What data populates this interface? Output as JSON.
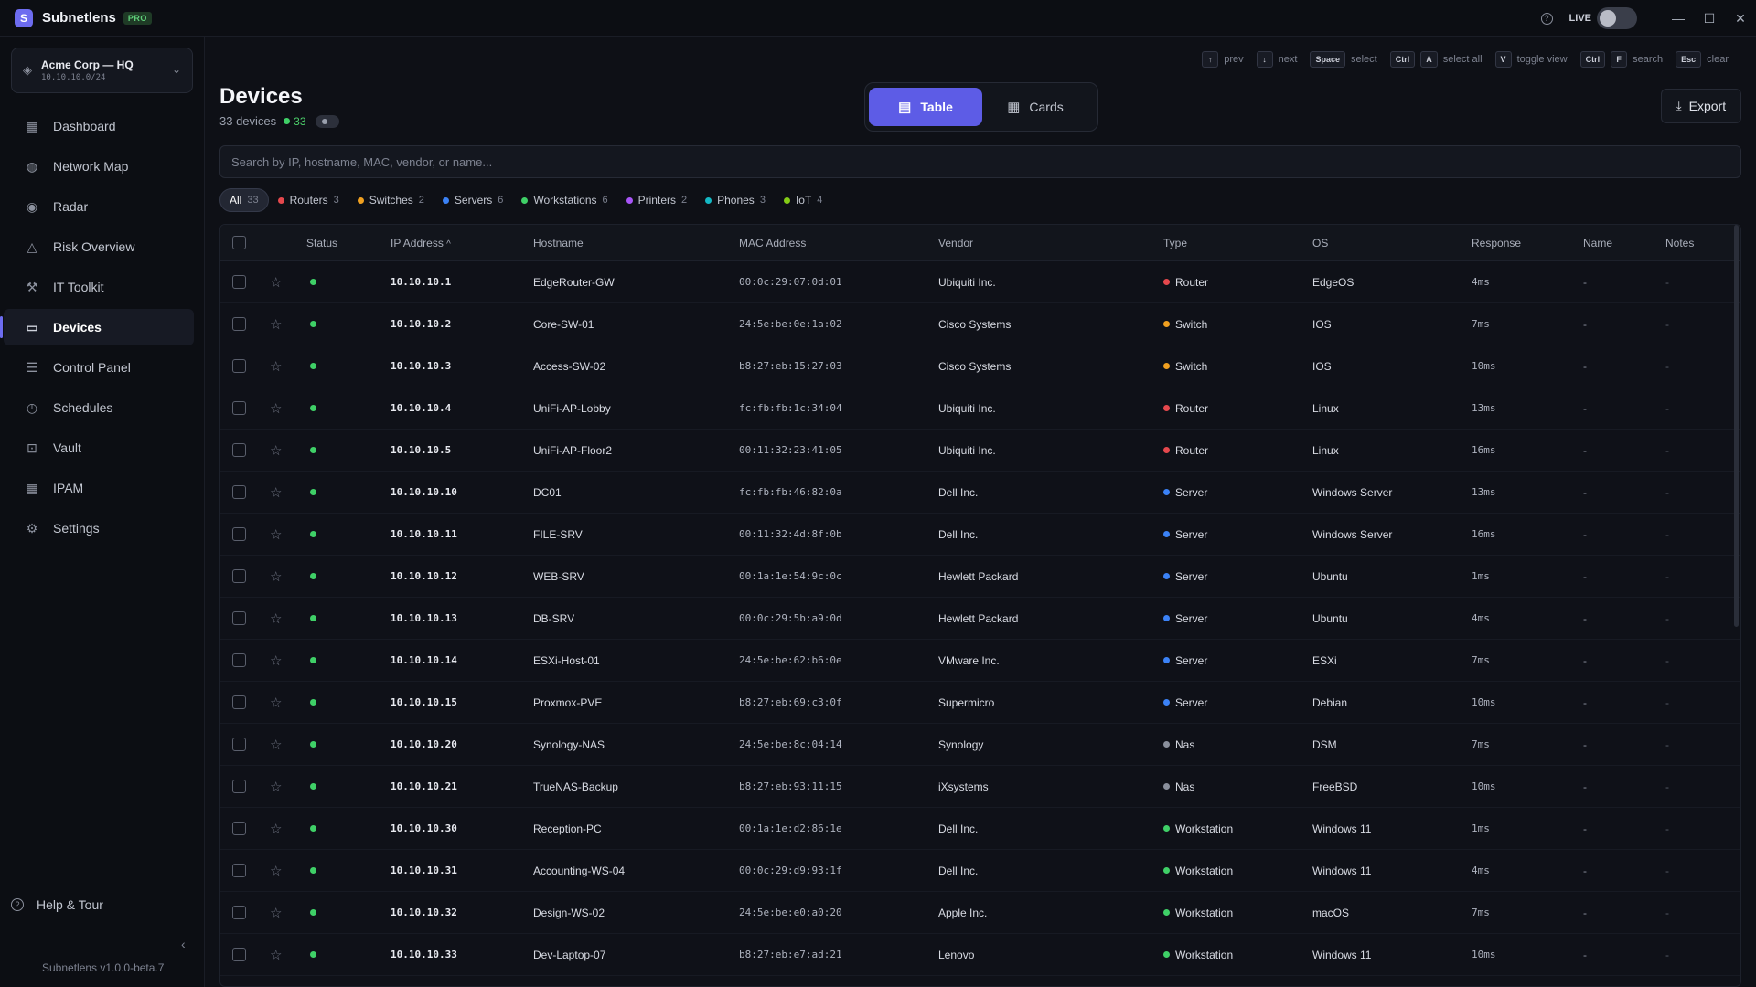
{
  "app": {
    "name": "Subnetlens",
    "badge": "PRO",
    "live_label": "LIVE",
    "version": "Subnetlens v1.0.0-beta.7"
  },
  "workspace": {
    "name": "Acme Corp — HQ",
    "subnet": "10.10.10.0/24"
  },
  "nav": [
    {
      "label": "Dashboard",
      "icon": "dashboard-icon",
      "glyph": "▦"
    },
    {
      "label": "Network Map",
      "icon": "globe-icon",
      "glyph": "◍"
    },
    {
      "label": "Radar",
      "icon": "radar-icon",
      "glyph": "◉"
    },
    {
      "label": "Risk Overview",
      "icon": "warning-icon",
      "glyph": "△"
    },
    {
      "label": "IT Toolkit",
      "icon": "toolkit-icon",
      "glyph": "⚒"
    },
    {
      "label": "Devices",
      "icon": "monitor-icon",
      "glyph": "▭"
    },
    {
      "label": "Control Panel",
      "icon": "sliders-icon",
      "glyph": "☰"
    },
    {
      "label": "Schedules",
      "icon": "clock-icon",
      "glyph": "◷"
    },
    {
      "label": "Vault",
      "icon": "lock-icon",
      "glyph": "⊡"
    },
    {
      "label": "IPAM",
      "icon": "grid-icon",
      "glyph": "▦"
    },
    {
      "label": "Settings",
      "icon": "gear-icon",
      "glyph": "⚙"
    }
  ],
  "active_nav": "Devices",
  "help": {
    "label": "Help & Tour"
  },
  "shortcuts": [
    {
      "keys": [
        "↑"
      ],
      "label": "prev"
    },
    {
      "keys": [
        "↓"
      ],
      "label": "next"
    },
    {
      "keys": [
        "Space"
      ],
      "label": "select"
    },
    {
      "keys": [
        "Ctrl",
        "A"
      ],
      "label": "select all"
    },
    {
      "keys": [
        "V"
      ],
      "label": "toggle view"
    },
    {
      "keys": [
        "Ctrl",
        "F"
      ],
      "label": "search"
    },
    {
      "keys": [
        "Esc"
      ],
      "label": "clear"
    }
  ],
  "page": {
    "title": "Devices",
    "device_count": "33 devices",
    "online_count": "33"
  },
  "view_switch": {
    "table_label": "Table",
    "cards_label": "Cards",
    "active": "Table"
  },
  "export_label": "Export",
  "search": {
    "placeholder": "Search by IP, hostname, MAC, vendor, or name...",
    "value": ""
  },
  "filters": [
    {
      "label": "All",
      "count": "33",
      "color": "",
      "active": true
    },
    {
      "label": "Routers",
      "count": "3",
      "color": "#e5484d"
    },
    {
      "label": "Switches",
      "count": "2",
      "color": "#f0a020"
    },
    {
      "label": "Servers",
      "count": "6",
      "color": "#3b82f6"
    },
    {
      "label": "Workstations",
      "count": "6",
      "color": "#3fd067"
    },
    {
      "label": "Printers",
      "count": "2",
      "color": "#a855f7"
    },
    {
      "label": "Phones",
      "count": "3",
      "color": "#14b8c4"
    },
    {
      "label": "IoT",
      "count": "4",
      "color": "#84cc16"
    }
  ],
  "table": {
    "columns": [
      "Status",
      "IP Address",
      "Hostname",
      "MAC Address",
      "Vendor",
      "Type",
      "OS",
      "Response",
      "Name",
      "Notes"
    ],
    "sort_indicator": "^",
    "type_colors": {
      "Router": "#e5484d",
      "Switch": "#f0a020",
      "Server": "#3b82f6",
      "Nas": "#8a8f9c",
      "Workstation": "#3fd067"
    },
    "rows": [
      {
        "ip": "10.10.10.1",
        "host": "EdgeRouter-GW",
        "mac": "00:0c:29:07:0d:01",
        "vendor": "Ubiquiti Inc.",
        "type": "Router",
        "os": "EdgeOS",
        "resp": "4ms",
        "name": "-",
        "notes": "-"
      },
      {
        "ip": "10.10.10.2",
        "host": "Core-SW-01",
        "mac": "24:5e:be:0e:1a:02",
        "vendor": "Cisco Systems",
        "type": "Switch",
        "os": "IOS",
        "resp": "7ms",
        "name": "-",
        "notes": "-"
      },
      {
        "ip": "10.10.10.3",
        "host": "Access-SW-02",
        "mac": "b8:27:eb:15:27:03",
        "vendor": "Cisco Systems",
        "type": "Switch",
        "os": "IOS",
        "resp": "10ms",
        "name": "-",
        "notes": "-"
      },
      {
        "ip": "10.10.10.4",
        "host": "UniFi-AP-Lobby",
        "mac": "fc:fb:fb:1c:34:04",
        "vendor": "Ubiquiti Inc.",
        "type": "Router",
        "os": "Linux",
        "resp": "13ms",
        "name": "-",
        "notes": "-"
      },
      {
        "ip": "10.10.10.5",
        "host": "UniFi-AP-Floor2",
        "mac": "00:11:32:23:41:05",
        "vendor": "Ubiquiti Inc.",
        "type": "Router",
        "os": "Linux",
        "resp": "16ms",
        "name": "-",
        "notes": "-"
      },
      {
        "ip": "10.10.10.10",
        "host": "DC01",
        "mac": "fc:fb:fb:46:82:0a",
        "vendor": "Dell Inc.",
        "type": "Server",
        "os": "Windows Server",
        "resp": "13ms",
        "name": "-",
        "notes": "-"
      },
      {
        "ip": "10.10.10.11",
        "host": "FILE-SRV",
        "mac": "00:11:32:4d:8f:0b",
        "vendor": "Dell Inc.",
        "type": "Server",
        "os": "Windows Server",
        "resp": "16ms",
        "name": "-",
        "notes": "-"
      },
      {
        "ip": "10.10.10.12",
        "host": "WEB-SRV",
        "mac": "00:1a:1e:54:9c:0c",
        "vendor": "Hewlett Packard",
        "type": "Server",
        "os": "Ubuntu",
        "resp": "1ms",
        "name": "-",
        "notes": "-"
      },
      {
        "ip": "10.10.10.13",
        "host": "DB-SRV",
        "mac": "00:0c:29:5b:a9:0d",
        "vendor": "Hewlett Packard",
        "type": "Server",
        "os": "Ubuntu",
        "resp": "4ms",
        "name": "-",
        "notes": "-"
      },
      {
        "ip": "10.10.10.14",
        "host": "ESXi-Host-01",
        "mac": "24:5e:be:62:b6:0e",
        "vendor": "VMware Inc.",
        "type": "Server",
        "os": "ESXi",
        "resp": "7ms",
        "name": "-",
        "notes": "-"
      },
      {
        "ip": "10.10.10.15",
        "host": "Proxmox-PVE",
        "mac": "b8:27:eb:69:c3:0f",
        "vendor": "Supermicro",
        "type": "Server",
        "os": "Debian",
        "resp": "10ms",
        "name": "-",
        "notes": "-"
      },
      {
        "ip": "10.10.10.20",
        "host": "Synology-NAS",
        "mac": "24:5e:be:8c:04:14",
        "vendor": "Synology",
        "type": "Nas",
        "os": "DSM",
        "resp": "7ms",
        "name": "-",
        "notes": "-"
      },
      {
        "ip": "10.10.10.21",
        "host": "TrueNAS-Backup",
        "mac": "b8:27:eb:93:11:15",
        "vendor": "iXsystems",
        "type": "Nas",
        "os": "FreeBSD",
        "resp": "10ms",
        "name": "-",
        "notes": "-"
      },
      {
        "ip": "10.10.10.30",
        "host": "Reception-PC",
        "mac": "00:1a:1e:d2:86:1e",
        "vendor": "Dell Inc.",
        "type": "Workstation",
        "os": "Windows 11",
        "resp": "1ms",
        "name": "-",
        "notes": "-"
      },
      {
        "ip": "10.10.10.31",
        "host": "Accounting-WS-04",
        "mac": "00:0c:29:d9:93:1f",
        "vendor": "Dell Inc.",
        "type": "Workstation",
        "os": "Windows 11",
        "resp": "4ms",
        "name": "-",
        "notes": "-"
      },
      {
        "ip": "10.10.10.32",
        "host": "Design-WS-02",
        "mac": "24:5e:be:e0:a0:20",
        "vendor": "Apple Inc.",
        "type": "Workstation",
        "os": "macOS",
        "resp": "7ms",
        "name": "-",
        "notes": "-"
      },
      {
        "ip": "10.10.10.33",
        "host": "Dev-Laptop-07",
        "mac": "b8:27:eb:e7:ad:21",
        "vendor": "Lenovo",
        "type": "Workstation",
        "os": "Windows 11",
        "resp": "10ms",
        "name": "-",
        "notes": "-"
      }
    ]
  }
}
